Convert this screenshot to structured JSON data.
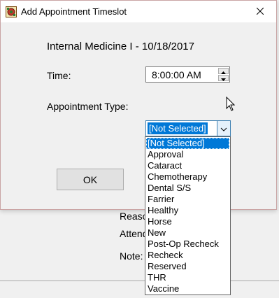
{
  "background": {
    "labels": [
      "Reaso",
      "Attend",
      "Note:"
    ]
  },
  "dialog": {
    "title": "Add Appointment Timeslot",
    "heading": "Internal Medicine I - 10/18/2017",
    "time_label": "Time:",
    "time_value": "8:00:00 AM",
    "type_label": "Appointment Type:",
    "type_selected": "[Not Selected]",
    "ok_label": "OK"
  },
  "dropdown": {
    "items": [
      "[Not Selected]",
      "Approval",
      "Cataract",
      "Chemotherapy",
      "Dental S/S",
      "Farrier",
      "Healthy",
      "Horse",
      "New",
      "Post-Op Recheck",
      "Recheck",
      "Reserved",
      "THR",
      "Vaccine"
    ],
    "selected_index": 0
  },
  "colors": {
    "highlight": "#0078d7",
    "dialog_border": "#c9a4a4",
    "combo_border": "#3c7fb1"
  },
  "icons": {
    "app": "app-icon",
    "close": "close-icon",
    "spin_up": "chevron-up-icon",
    "spin_down": "chevron-down-icon",
    "combo_arrow": "chevron-down-icon",
    "cursor": "mouse-cursor-icon"
  }
}
